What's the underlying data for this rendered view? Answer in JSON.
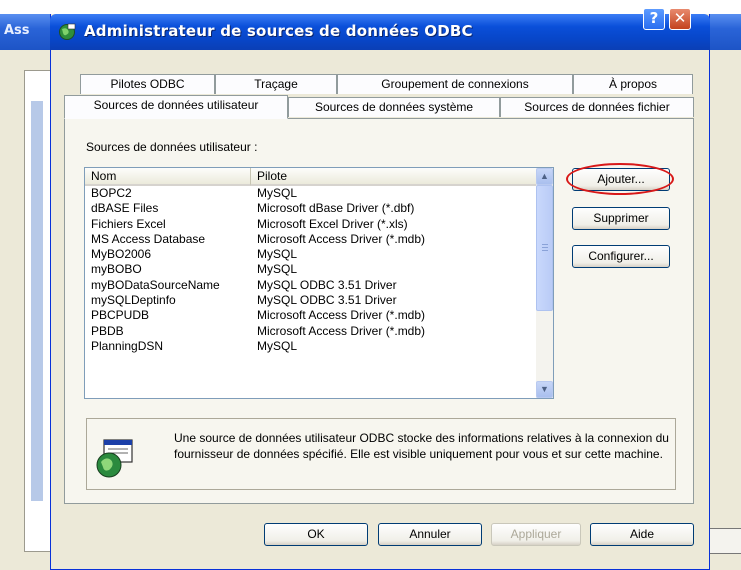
{
  "background_window": {
    "title_fragment": "Ass"
  },
  "dialog": {
    "title": "Administrateur de sources de données ODBC",
    "help_glyph": "?",
    "close_glyph": "✕"
  },
  "tabs": {
    "row_back": [
      {
        "label": "Pilotes ODBC"
      },
      {
        "label": "Traçage"
      },
      {
        "label": "Groupement de connexions"
      },
      {
        "label": "À propos"
      }
    ],
    "row_front": [
      {
        "label": "Sources de données utilisateur",
        "active": true
      },
      {
        "label": "Sources de données système"
      },
      {
        "label": "Sources de données fichier"
      }
    ]
  },
  "panel": {
    "group_label": "Sources de données utilisateur :",
    "columns": {
      "name": "Nom",
      "driver": "Pilote"
    },
    "rows": [
      {
        "name": "BOPC2",
        "driver": "MySQL"
      },
      {
        "name": "dBASE Files",
        "driver": "Microsoft dBase Driver (*.dbf)"
      },
      {
        "name": "Fichiers Excel",
        "driver": "Microsoft Excel Driver (*.xls)"
      },
      {
        "name": "MS Access Database",
        "driver": "Microsoft Access Driver (*.mdb)"
      },
      {
        "name": "MyBO2006",
        "driver": "MySQL"
      },
      {
        "name": "myBOBO",
        "driver": "MySQL"
      },
      {
        "name": "myBODataSourceName",
        "driver": "MySQL ODBC 3.51 Driver"
      },
      {
        "name": "mySQLDeptinfo",
        "driver": "MySQL ODBC 3.51 Driver"
      },
      {
        "name": "PBCPUDB",
        "driver": "Microsoft Access Driver (*.mdb)"
      },
      {
        "name": "PBDB",
        "driver": "Microsoft Access Driver (*.mdb)"
      },
      {
        "name": "PlanningDSN",
        "driver": "MySQL"
      }
    ],
    "buttons": {
      "add": "Ajouter...",
      "remove": "Supprimer",
      "configure": "Configurer..."
    },
    "info_text": "Une source de données utilisateur ODBC stocke des informations relatives à la connexion du fournisseur de données spécifié. Elle est visible uniquement pour vous et sur cette machine."
  },
  "footer": {
    "ok": "OK",
    "cancel": "Annuler",
    "apply": "Appliquer",
    "help": "Aide"
  },
  "colors": {
    "title_bar": "#0a4fd9",
    "annotation_circle": "#d81818",
    "dialog_bg": "#ece9d8"
  }
}
